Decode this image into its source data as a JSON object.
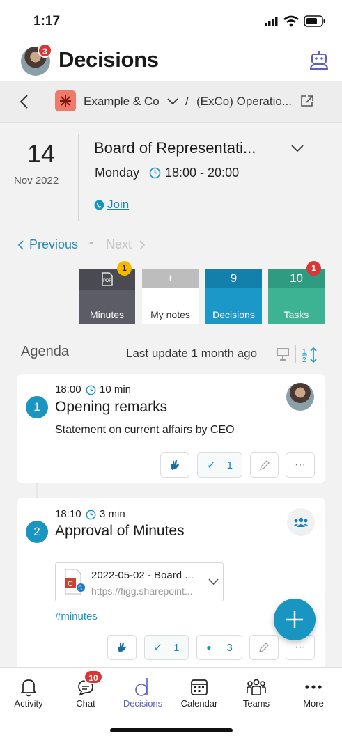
{
  "status": {
    "time": "1:17"
  },
  "header": {
    "title": "Decisions",
    "avatar_badge": "3"
  },
  "breadcrumb": {
    "org": "Example & Co",
    "separator": "/",
    "group": "(ExCo) Operatio..."
  },
  "meeting": {
    "day": "14",
    "month_year": "Nov 2022",
    "title": "Board of Representati...",
    "weekday": "Monday",
    "time_range": "18:00 - 20:00",
    "join_label": "Join"
  },
  "pager": {
    "previous": "Previous",
    "dot": "•",
    "next": "Next"
  },
  "tiles": [
    {
      "label": "Minutes",
      "top": "",
      "badge": "1",
      "top_color": "#4a4a52",
      "bottom_color": "#5c5c66"
    },
    {
      "label": "My notes",
      "top": "+",
      "badge": "",
      "top_color": "#bdbdbd",
      "bottom_color": "#ffffff"
    },
    {
      "label": "Decisions",
      "top": "9",
      "badge": "",
      "top_color": "#1380ab",
      "bottom_color": "#1c98c8"
    },
    {
      "label": "Tasks",
      "top": "10",
      "badge": "1",
      "top_color": "#2f9b80",
      "bottom_color": "#3db393"
    }
  ],
  "agenda": {
    "heading": "Agenda",
    "last_update": "Last update 1 month ago",
    "items": [
      {
        "number": "1",
        "start": "18:00",
        "duration": "10 min",
        "title": "Opening remarks",
        "description": "Statement on current affairs by CEO",
        "check_count": "1"
      },
      {
        "number": "2",
        "start": "18:10",
        "duration": "3 min",
        "title": "Approval of Minutes",
        "attachment_name": "2022-05-02 - Board ...",
        "attachment_url": "https://figg.sharepoint...",
        "tag": "#minutes",
        "check_count": "1",
        "dot_count": "3"
      }
    ]
  },
  "tabbar": {
    "items": [
      {
        "label": "Activity",
        "icon": "bell-icon"
      },
      {
        "label": "Chat",
        "icon": "chat-icon",
        "badge": "10"
      },
      {
        "label": "Decisions",
        "icon": "decisions-icon"
      },
      {
        "label": "Calendar",
        "icon": "calendar-icon"
      },
      {
        "label": "Teams",
        "icon": "teams-icon"
      },
      {
        "label": "More",
        "icon": "more-icon"
      }
    ]
  },
  "colors": {
    "accent": "#1995c2",
    "badge_red": "#d93636",
    "badge_yellow": "#f5b800",
    "decisions_purple": "#5b5fc7"
  }
}
